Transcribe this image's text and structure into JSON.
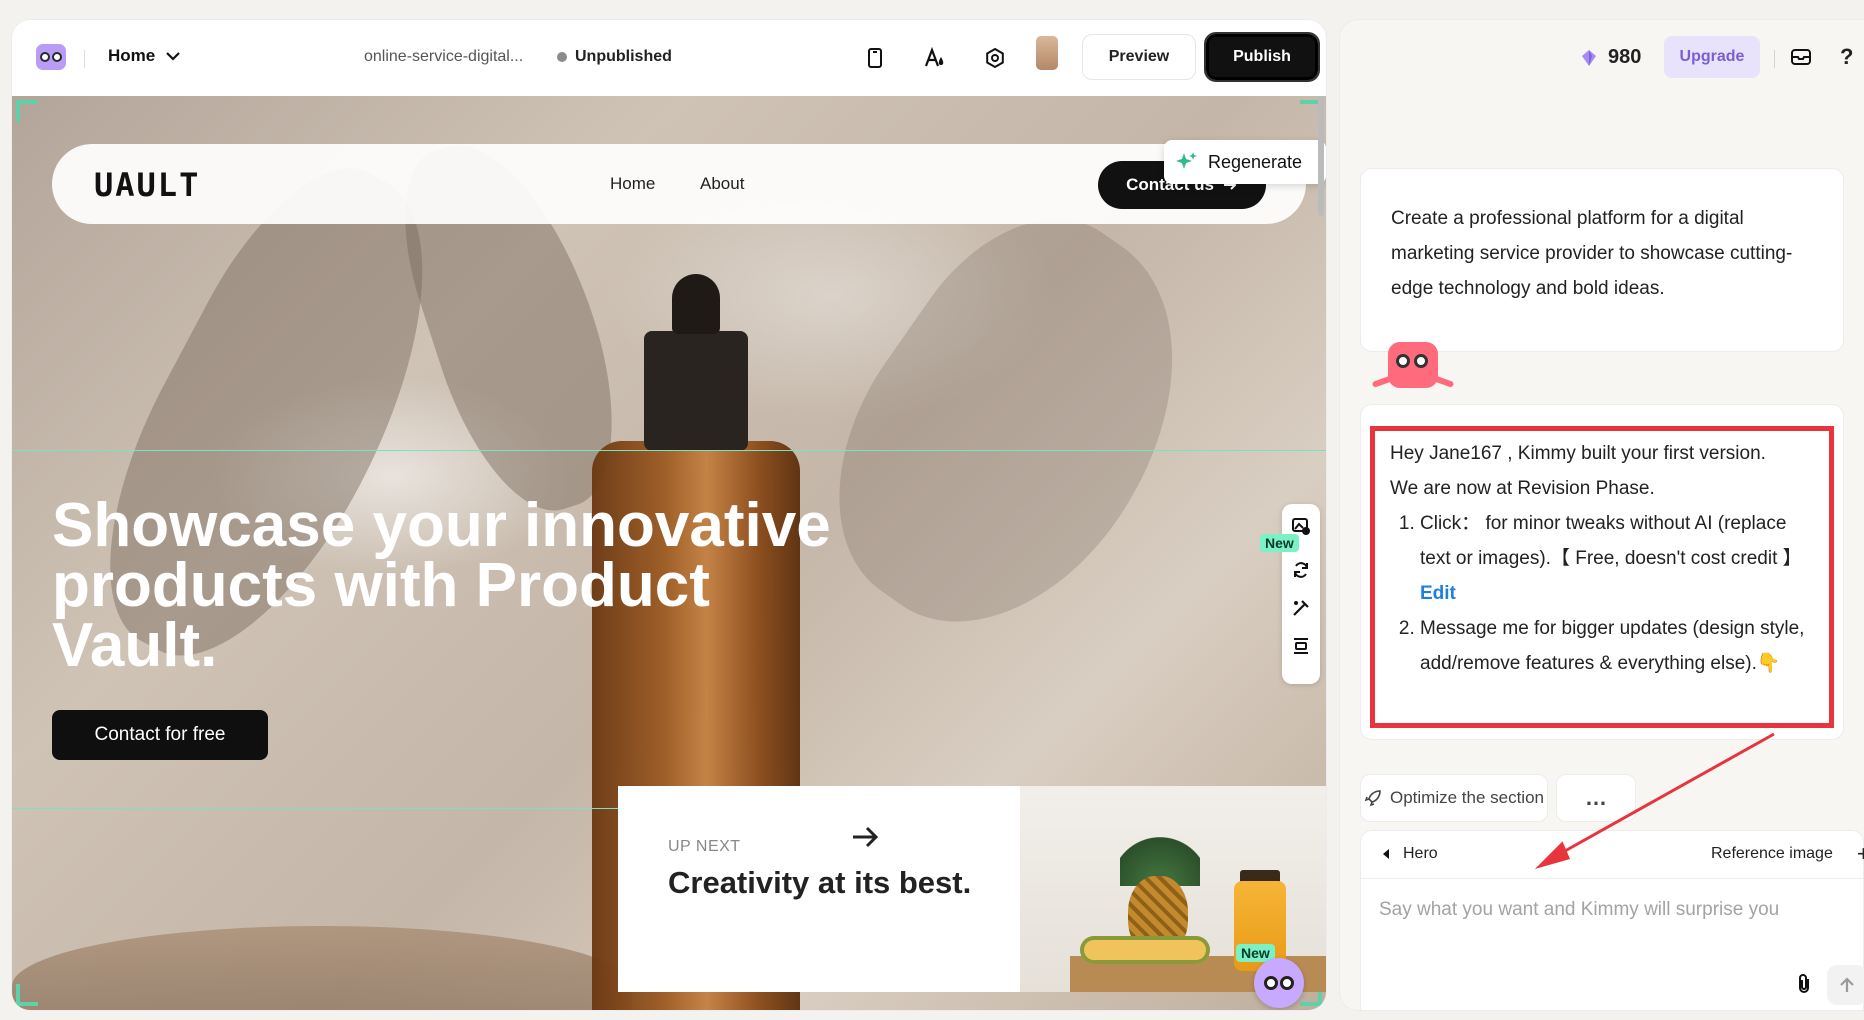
{
  "topbar": {
    "home_label": "Home",
    "site_name": "online-service-digital...",
    "status": "Unpublished",
    "preview_label": "Preview",
    "publish_label": "Publish"
  },
  "site": {
    "brand": "UAULT",
    "nav": [
      "Home",
      "About"
    ],
    "contact_label": "Contact us",
    "regenerate_label": "Regenerate",
    "hero_title": "Showcase your innovative products with Product Vault.",
    "cta_label": "Contact for free",
    "upnext_kicker": "UP NEXT",
    "upnext_title": "Creativity at its best.",
    "new_badge": "New"
  },
  "chat": {
    "credits": "980",
    "upgrade_label": "Upgrade",
    "help": "?",
    "user_message": "Create a professional platform for a digital marketing service provider to showcase cutting-edge technology and bold ideas.",
    "bot_greeting": "Hey Jane167 , Kimmy built your first version.",
    "bot_phase": "We are now at Revision Phase.",
    "bot_step1": "Click： for minor tweaks without AI (replace text or images).【 Free, doesn't cost credit 】",
    "bot_step1_link": "Edit",
    "bot_step2": "Message me for bigger updates (design style, add/remove features & everything else).",
    "bot_step2_emoji": "👇",
    "optimize_label": "Optimize the section",
    "more_label": "…",
    "section_tag": "Hero",
    "reference_label": "Reference image",
    "reference_plus": "+",
    "placeholder": "Say what you want and Kimmy will surprise you"
  },
  "colors": {
    "accent_green": "#5fd1a8",
    "highlight_red": "#e8343c",
    "upgrade_purple": "#7b5ed6",
    "link_blue": "#1e7fe0"
  }
}
